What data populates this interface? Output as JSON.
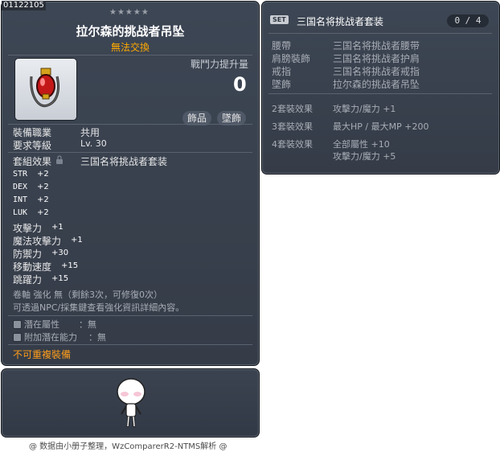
{
  "item": {
    "id": "01122105",
    "stars": "★★★★★",
    "name": "拉尔森的挑战者吊坠",
    "tradeable_status": "無法交換",
    "attack_increase_label": "戰鬥力提升量",
    "attack_increase_value": "0",
    "tags": [
      "飾品",
      "墜飾"
    ],
    "job_label": "裝備職業",
    "job_value": "共用",
    "level_label": "要求等級",
    "level_value": "Lv. 30",
    "set_label": "套組效果",
    "set_value": "三国名将挑战者套装",
    "stats": [
      {
        "name": "STR",
        "value": "+2"
      },
      {
        "name": "DEX",
        "value": "+2"
      },
      {
        "name": "INT",
        "value": "+2"
      },
      {
        "name": "LUK",
        "value": "+2"
      }
    ],
    "bonuses": [
      {
        "name": "攻擊力",
        "value": "+1"
      },
      {
        "name": "魔法攻擊力",
        "value": "+1"
      },
      {
        "name": "防禦力",
        "value": "+30"
      },
      {
        "name": "移動速度",
        "value": "+15"
      },
      {
        "name": "跳躍力",
        "value": "+15"
      }
    ],
    "scroll_info": "卷軸 強化 無（剩餘3次，可修復0次）",
    "npc_info": "可透過NPC/採集鍵查看強化資訊詳細內容。",
    "potential_label": "潛在屬性",
    "potential_value": "：無",
    "bonus_potential_label": "附加潛在能力",
    "bonus_potential_value": "：無",
    "unique_note": "不可重複裝備"
  },
  "set": {
    "badge": "SET",
    "name": "三国名将挑战者套装",
    "count": "0 / 4",
    "items": [
      {
        "category": "腰帶",
        "name": "三国名将挑战者腰带"
      },
      {
        "category": "肩膀裝飾",
        "name": "三国名将挑战者护肩"
      },
      {
        "category": "戒指",
        "name": "三国名将挑战者戒指"
      },
      {
        "category": "墜飾",
        "name": "拉尔森的挑战者吊坠"
      }
    ],
    "effects": [
      {
        "label": "2套裝效果",
        "lines": [
          "攻擊力/魔力 +1"
        ]
      },
      {
        "label": "3套裝效果",
        "lines": [
          "最大HP / 最大MP  +200"
        ]
      },
      {
        "label": "4套裝效果",
        "lines": [
          "全部屬性 +10",
          "攻擊力/魔力 +5"
        ]
      }
    ]
  },
  "footer": "@ 数据由小册子整理，WzComparerR2-NTMS解析 @",
  "colors": {
    "panel_bg": "#3a424f",
    "name_color": "#ffffff",
    "untradeable": "#ffaa00",
    "unique": "#ff9d1a",
    "muted": "#a8adb5"
  }
}
